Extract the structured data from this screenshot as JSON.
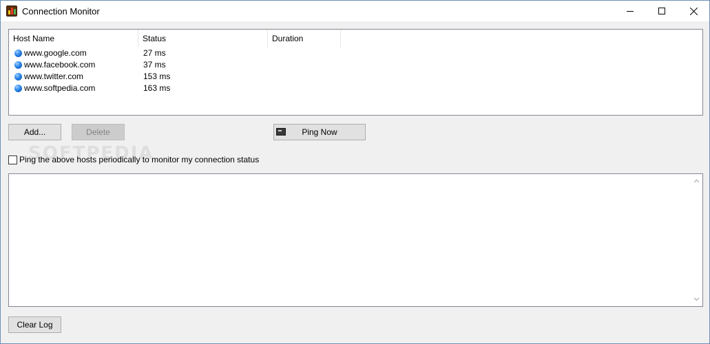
{
  "window": {
    "title": "Connection Monitor",
    "accent": "#6b8fb8"
  },
  "icons": {
    "app": "bar-chart-app-icon",
    "minimize": "minimize-icon",
    "maximize": "maximize-icon",
    "close": "close-icon",
    "host_status": "blue-globe-dot-icon",
    "ping": "terminal-icon"
  },
  "hosts_list": {
    "columns": [
      "Host Name",
      "Status",
      "Duration"
    ],
    "rows": [
      {
        "host": "www.google.com",
        "status": "27 ms"
      },
      {
        "host": "www.facebook.com",
        "status": "37 ms"
      },
      {
        "host": "www.twitter.com",
        "status": "153 ms"
      },
      {
        "host": "www.softpedia.com",
        "status": "163 ms"
      }
    ]
  },
  "buttons": {
    "add": "Add...",
    "delete": "Delete",
    "ping_now": "Ping Now",
    "clear_log": "Clear Log"
  },
  "periodic_ping": {
    "label": "Ping the above hosts periodically to monitor my connection status",
    "checked": false
  },
  "watermark": "SOFTPEDIA",
  "log": {
    "text": ""
  }
}
